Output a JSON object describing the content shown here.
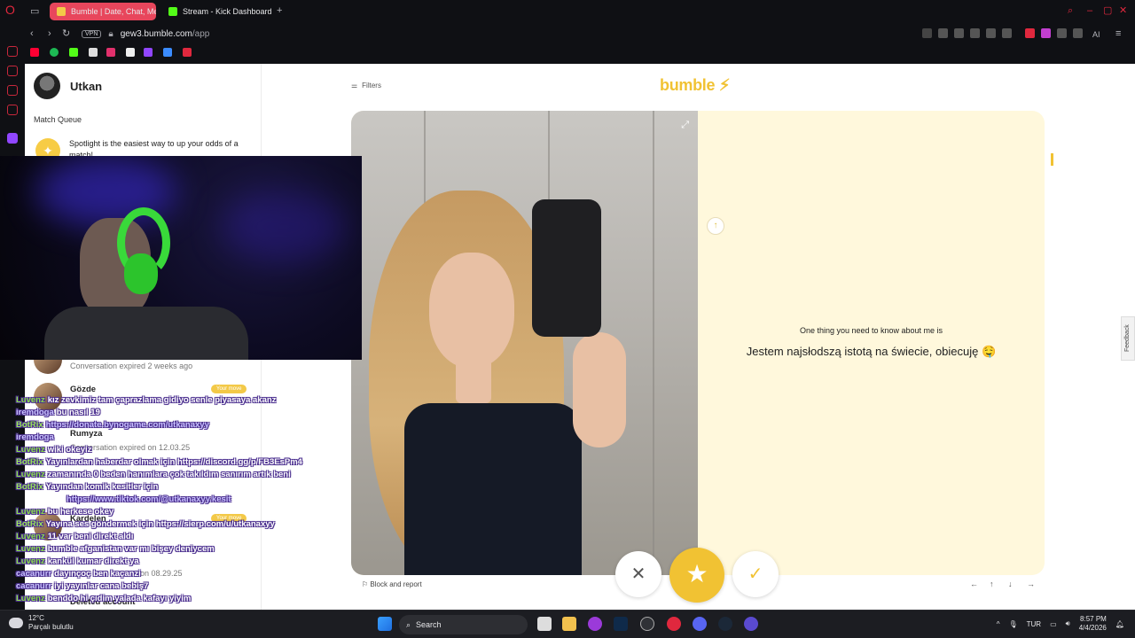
{
  "browser": {
    "tabs": [
      {
        "label": "Bumble | Date, Chat, Meet",
        "color": "#f3c948",
        "active": true
      },
      {
        "label": "Stream - Kick Dashboard",
        "color": "#53fc18",
        "active": false
      }
    ],
    "new_tab": "+",
    "vpn_label": "VPN",
    "url_host": "gew3.bumble.com",
    "url_path": "/app",
    "ai_label": "AI"
  },
  "sidebar": {
    "user_name": "Utkan",
    "match_queue_label": "Match Queue",
    "spotlight_text": "Spotlight is the easiest way to up your odds of a match!",
    "conversations": [
      {
        "name": "",
        "sub": "Conversation expired 2 weeks ago",
        "badge": ""
      },
      {
        "name": "Gözde",
        "sub": "",
        "badge": "Your move"
      },
      {
        "name": "Rumyza",
        "sub": "Conversation expired on 12.03.25",
        "badge": ""
      },
      {
        "name": "Kardelen",
        "sub": "",
        "badge": "Your move"
      },
      {
        "name": "",
        "sub": "on 08.29.25",
        "badge": ""
      },
      {
        "name": "Deleted account",
        "sub": "",
        "badge": ""
      }
    ]
  },
  "main": {
    "filters_label": "Filters",
    "logo": "bumble",
    "prompt_label": "One thing you need to know about me is",
    "prompt_answer": "Jestem najsłodszą istotą na świecie, obiecuję 🤤",
    "block_report": "Block and report",
    "feedback": "Feedback",
    "actions": {
      "pass": "✕",
      "superswipe": "★",
      "like": "✓"
    },
    "nav_keys": [
      "←",
      "↑",
      "↓",
      "→"
    ]
  },
  "chat": [
    {
      "user": "Luvenz",
      "text": "kız zevkimiz tam çaprazlama gidiyo senle piyasaya akanz",
      "type": "user"
    },
    {
      "user": "iremdoga",
      "text": "bu nasıl 19",
      "type": "alt"
    },
    {
      "user": "BotRix",
      "text": "https://donate.bynogame.com/utkanaxyy",
      "type": "bot",
      "link": true
    },
    {
      "user": "iremdoga",
      "text": "",
      "type": "alt"
    },
    {
      "user": "Luvenz",
      "text": "wiki okeyiz",
      "type": "user"
    },
    {
      "user": "BotRix",
      "text": "Yayınlardan haberdar olmak için https://discord.gg/p/FB3EsPm4",
      "type": "bot"
    },
    {
      "user": "Luvenz",
      "text": "zamanında 0 beden hanımlara çok takıldım sanırım artık beni",
      "type": "user"
    },
    {
      "user": "BotRix",
      "text": "Yayından komik kesitler için",
      "type": "bot"
    },
    {
      "user": "",
      "text": "https://www.tiktok.com/@utkanaxyy.kesit",
      "type": "cont",
      "link": true
    },
    {
      "user": "Luvenz",
      "text": "bu herkese okey",
      "type": "user"
    },
    {
      "user": "BotRix",
      "text": "Yayına ses göndermek için https://sierp.com/u/utkanaxyy",
      "type": "bot"
    },
    {
      "user": "Luvenz",
      "text": "11 var beni direkt aldı",
      "type": "user"
    },
    {
      "user": "Luvenz",
      "text": "bumble afganistan var mı bişey deniycem",
      "type": "user"
    },
    {
      "user": "Luvenz",
      "text": "kankül kumar direkt ya",
      "type": "user"
    },
    {
      "user": "cacanurr",
      "text": "dayınçoç ben kaçanzi",
      "type": "alt"
    },
    {
      "user": "cacanurr",
      "text": "iyi yayınlar cana bebiş7",
      "type": "alt"
    },
    {
      "user": "Luvenz",
      "text": "benddo hi çıdim yalada kafayı yiyim",
      "type": "user"
    }
  ],
  "taskbar": {
    "weather_temp": "12°C",
    "weather_desc": "Parçalı bulutlu",
    "search_label": "Search",
    "language": "TUR",
    "time": "8:57 PM",
    "date": "4/4/2026"
  },
  "colors": {
    "bumble_yellow": "#f1c233",
    "card_bg": "#fff8dc",
    "tab_active": "#e8465c"
  }
}
